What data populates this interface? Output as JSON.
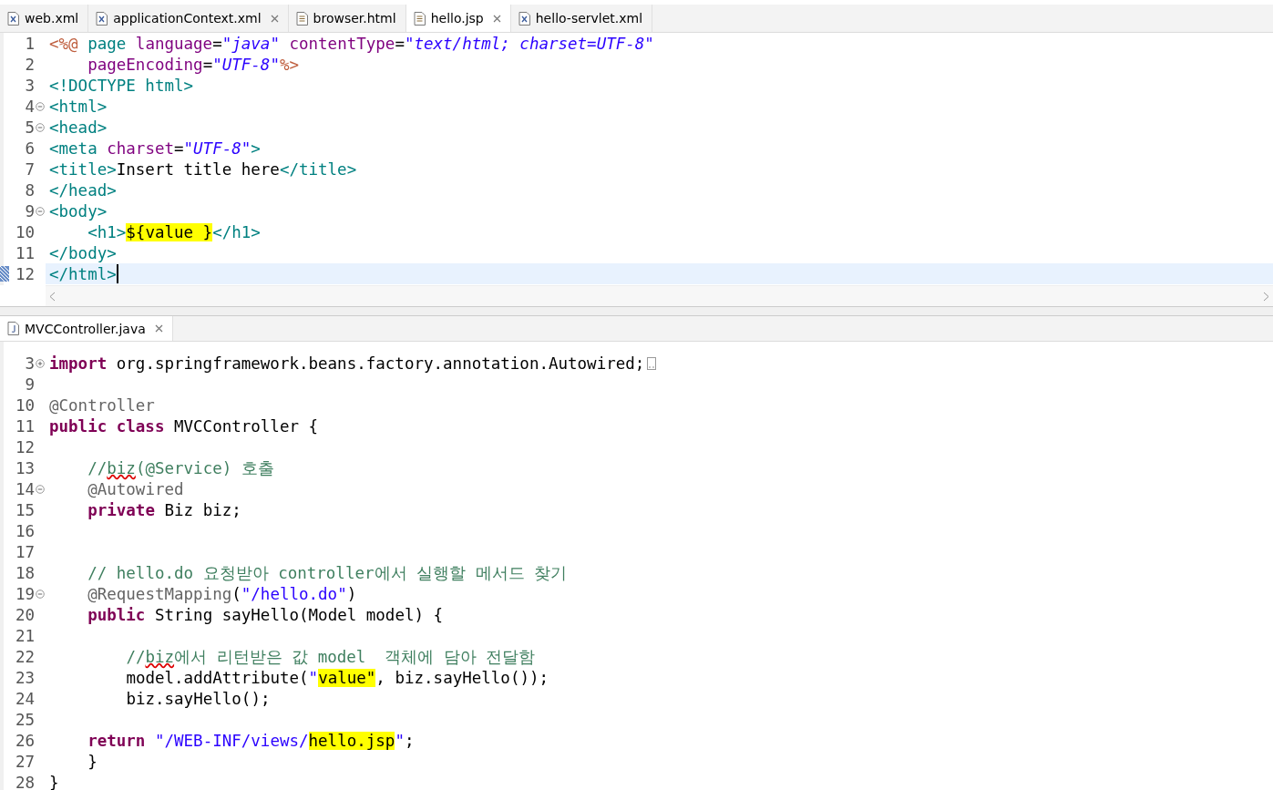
{
  "top_tabs": [
    {
      "label": "web.xml",
      "kind": "xml",
      "selected": false,
      "closable": false
    },
    {
      "label": "applicationContext.xml",
      "kind": "xml",
      "selected": false,
      "closable": true
    },
    {
      "label": "browser.html",
      "kind": "html",
      "selected": false,
      "closable": false
    },
    {
      "label": "hello.jsp",
      "kind": "html",
      "selected": true,
      "closable": true
    },
    {
      "label": "hello-servlet.xml",
      "kind": "xml",
      "selected": false,
      "closable": false
    }
  ],
  "top_editor": {
    "lines": [
      {
        "number": "1",
        "collapsible": false,
        "collapsed": false,
        "current": false,
        "parts": [
          {
            "kind": "code",
            "text": "<%@ page language=\"java\" contentType=\"text/html; charset=UTF-8\""
          }
        ]
      },
      {
        "number": "2",
        "collapsible": false,
        "collapsed": false,
        "current": false,
        "parts": [
          {
            "kind": "code",
            "text": "    pageEncoding=\"UTF-8\"%>"
          }
        ]
      },
      {
        "number": "3",
        "collapsible": false,
        "collapsed": false,
        "current": false,
        "parts": [
          {
            "kind": "code",
            "text": "<!DOCTYPE html>"
          }
        ]
      },
      {
        "number": "4",
        "collapsible": true,
        "collapsed": false,
        "current": false,
        "parts": [
          {
            "kind": "code",
            "text": "<html>"
          }
        ]
      },
      {
        "number": "5",
        "collapsible": true,
        "collapsed": false,
        "current": false,
        "parts": [
          {
            "kind": "code",
            "text": "<head>"
          }
        ]
      },
      {
        "number": "6",
        "collapsible": false,
        "collapsed": false,
        "current": false,
        "parts": [
          {
            "kind": "code",
            "text": "<meta charset=\"UTF-8\">"
          }
        ]
      },
      {
        "number": "7",
        "collapsible": false,
        "collapsed": false,
        "current": false,
        "parts": [
          {
            "kind": "code",
            "text": "<title>Insert title here</title>"
          }
        ]
      },
      {
        "number": "8",
        "collapsible": false,
        "collapsed": false,
        "current": false,
        "parts": [
          {
            "kind": "code",
            "text": "</head>"
          }
        ]
      },
      {
        "number": "9",
        "collapsible": true,
        "collapsed": false,
        "current": false,
        "parts": [
          {
            "kind": "code",
            "text": "<body>"
          }
        ]
      },
      {
        "number": "10",
        "collapsible": false,
        "collapsed": false,
        "current": false,
        "parts": [
          {
            "kind": "code",
            "text": "    <h1>"
          },
          {
            "kind": "match",
            "text": "${value }"
          },
          {
            "kind": "code",
            "text": "</h1>"
          }
        ]
      },
      {
        "number": "11",
        "collapsible": false,
        "collapsed": false,
        "current": false,
        "parts": [
          {
            "kind": "code",
            "text": "</body>"
          }
        ]
      },
      {
        "number": "12",
        "collapsible": false,
        "collapsed": false,
        "current": true,
        "parts": [
          {
            "kind": "code",
            "text": "</html>"
          }
        ]
      }
    ]
  },
  "bottom_tabs": [
    {
      "label": "MVCController.java",
      "kind": "java",
      "selected": true,
      "closable": true
    }
  ],
  "bottom_editor": {
    "lines": [
      {
        "number": "3",
        "collapsible": true,
        "collapsed": true,
        "current": false,
        "parts": [
          {
            "kind": "code",
            "text": "import org.springframework.beans.factory.annotation.Autowired;"
          }
        ]
      },
      {
        "number": "9",
        "collapsible": false,
        "collapsed": false,
        "current": false
      },
      {
        "number": "10",
        "collapsible": false,
        "collapsed": false,
        "current": false,
        "parts": [
          {
            "kind": "code",
            "text": "@Controller"
          }
        ]
      },
      {
        "number": "11",
        "collapsible": false,
        "collapsed": false,
        "current": false,
        "parts": [
          {
            "kind": "code",
            "text": "public class MVCController {"
          }
        ]
      },
      {
        "number": "12",
        "collapsible": false,
        "collapsed": false,
        "current": false
      },
      {
        "number": "13",
        "collapsible": false,
        "collapsed": false,
        "current": false,
        "parts": [
          {
            "kind": "code",
            "text": "    //"
          },
          {
            "kind": "misspelled",
            "text": "biz"
          },
          {
            "kind": "code",
            "text": "(@Service) 호출"
          }
        ]
      },
      {
        "number": "14",
        "collapsible": true,
        "collapsed": false,
        "current": false,
        "parts": [
          {
            "kind": "code",
            "text": "    @Autowired"
          }
        ]
      },
      {
        "number": "15",
        "collapsible": false,
        "collapsed": false,
        "current": false,
        "parts": [
          {
            "kind": "code",
            "text": "    private Biz biz;"
          }
        ]
      },
      {
        "number": "16",
        "collapsible": false,
        "collapsed": false,
        "current": false
      },
      {
        "number": "17",
        "collapsible": false,
        "collapsed": false,
        "current": false
      },
      {
        "number": "18",
        "collapsible": false,
        "collapsed": false,
        "current": false,
        "parts": [
          {
            "kind": "code",
            "text": "    // hello.do 요청받아 controller에서 실행할 메서드 찾기"
          }
        ]
      },
      {
        "number": "19",
        "collapsible": true,
        "collapsed": false,
        "current": false,
        "parts": [
          {
            "kind": "code",
            "text": "    @RequestMapping(\"/hello.do\")"
          }
        ]
      },
      {
        "number": "20",
        "collapsible": false,
        "collapsed": false,
        "current": false,
        "parts": [
          {
            "kind": "code",
            "text": "    public String sayHello(Model model) {"
          }
        ]
      },
      {
        "number": "21",
        "collapsible": false,
        "collapsed": false,
        "current": false
      },
      {
        "number": "22",
        "collapsible": false,
        "collapsed": false,
        "current": false,
        "parts": [
          {
            "kind": "code",
            "text": "        //"
          },
          {
            "kind": "misspelled",
            "text": "biz"
          },
          {
            "kind": "code",
            "text": "에서 리턴받은 값 model  객체에 담아 전달함"
          }
        ]
      },
      {
        "number": "23",
        "collapsible": false,
        "collapsed": false,
        "current": false,
        "parts": [
          {
            "kind": "code",
            "text": "        model.addAttribute(\""
          },
          {
            "kind": "match",
            "text": "value\""
          },
          {
            "kind": "code",
            "text": ", biz.sayHello());"
          }
        ]
      },
      {
        "number": "24",
        "collapsible": false,
        "collapsed": false,
        "current": false,
        "parts": [
          {
            "kind": "code",
            "text": "        biz.sayHello();"
          }
        ]
      },
      {
        "number": "25",
        "collapsible": false,
        "collapsed": false,
        "current": false
      },
      {
        "number": "26",
        "collapsible": false,
        "collapsed": false,
        "current": false,
        "parts": [
          {
            "kind": "code",
            "text": "    return \"/WEB-INF/views/"
          },
          {
            "kind": "match",
            "text": "hello.jsp"
          },
          {
            "kind": "code",
            "text": "\";"
          }
        ]
      },
      {
        "number": "27",
        "collapsible": false,
        "collapsed": false,
        "current": false,
        "parts": [
          {
            "kind": "code",
            "text": "    }"
          }
        ]
      },
      {
        "number": "28",
        "collapsible": false,
        "collapsed": false,
        "current": false,
        "parts": [
          {
            "kind": "code",
            "text": "}"
          }
        ]
      }
    ]
  }
}
